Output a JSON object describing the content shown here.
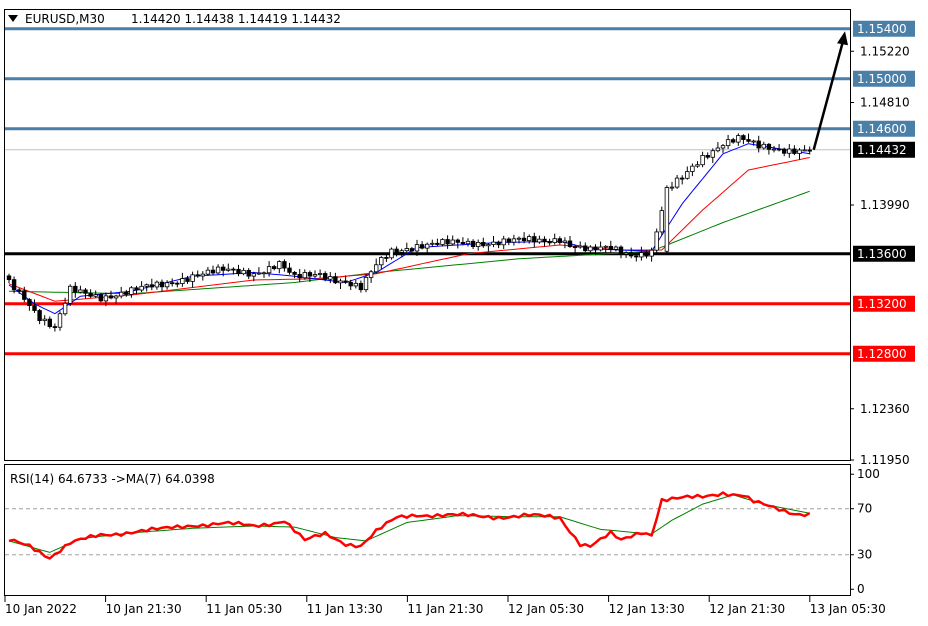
{
  "header": {
    "menu_icon": "triangle-down-icon",
    "symbol": "EURUSD,M30",
    "ohlc": "1.14420 1.14438 1.14419 1.14432"
  },
  "rsi_header": "RSI(14) 64.6733  ->MA(7) 64.0398",
  "colors": {
    "up_candle": "#ffffff",
    "down_candle": "#000000",
    "ma_fast": "#0000ff",
    "ma_mid": "#ff0000",
    "ma_slow": "#008000",
    "resistance_line": "#4a7fa8",
    "support_line": "#ff0000",
    "pivot_line": "#000000",
    "rsi_line": "#ff0000",
    "rsi_ma": "#008000",
    "arrow": "#000000"
  },
  "chart_data": [
    {
      "type": "candlestick",
      "title": "EURUSD,M30",
      "x_ticks": [
        "10 Jan 2022",
        "10 Jan 21:30",
        "11 Jan 05:30",
        "11 Jan 13:30",
        "11 Jan 21:30",
        "12 Jan 05:30",
        "12 Jan 13:30",
        "12 Jan 21:30",
        "13 Jan 05:30"
      ],
      "y_ticks": [
        "1.15220",
        "1.14810",
        "1.13990",
        "1.12360",
        "1.11950"
      ],
      "ylim": [
        1.1195,
        1.1555
      ],
      "current_price": {
        "label": "1.14432",
        "value": 1.14432
      },
      "horizontal_levels": [
        {
          "label": "1.15400",
          "value": 1.154,
          "kind": "resistance"
        },
        {
          "label": "1.15000",
          "value": 1.15,
          "kind": "resistance"
        },
        {
          "label": "1.14600",
          "value": 1.146,
          "kind": "resistance"
        },
        {
          "label": "1.13600",
          "value": 1.136,
          "kind": "pivot"
        },
        {
          "label": "1.13200",
          "value": 1.132,
          "kind": "support"
        },
        {
          "label": "1.12800",
          "value": 1.128,
          "kind": "support"
        }
      ],
      "anchors": [
        [
          0,
          1.1337
        ],
        [
          3,
          1.1326
        ],
        [
          6,
          1.131
        ],
        [
          9,
          1.13
        ],
        [
          12,
          1.133
        ],
        [
          18,
          1.1326
        ],
        [
          24,
          1.133
        ],
        [
          30,
          1.1335
        ],
        [
          36,
          1.1343
        ],
        [
          42,
          1.1346
        ],
        [
          48,
          1.1345
        ],
        [
          53,
          1.1352
        ],
        [
          56,
          1.134
        ],
        [
          61,
          1.1344
        ],
        [
          66,
          1.1338
        ],
        [
          69,
          1.1332
        ],
        [
          72,
          1.135
        ],
        [
          75,
          1.1362
        ],
        [
          80,
          1.1367
        ],
        [
          88,
          1.1368
        ],
        [
          96,
          1.137
        ],
        [
          105,
          1.137
        ],
        [
          108,
          1.1373
        ],
        [
          110,
          1.1368
        ],
        [
          114,
          1.1362
        ],
        [
          118,
          1.1364
        ],
        [
          122,
          1.136
        ],
        [
          126,
          1.1362
        ],
        [
          129,
          1.141
        ],
        [
          132,
          1.142
        ],
        [
          136,
          1.1438
        ],
        [
          140,
          1.1449
        ],
        [
          143,
          1.1452
        ],
        [
          147,
          1.1445
        ],
        [
          152,
          1.1444
        ],
        [
          157,
          1.1443
        ]
      ],
      "ma_fast_anchors": [
        [
          0,
          1.1335
        ],
        [
          5,
          1.132
        ],
        [
          9,
          1.1312
        ],
        [
          14,
          1.1326
        ],
        [
          24,
          1.133
        ],
        [
          36,
          1.1342
        ],
        [
          48,
          1.1345
        ],
        [
          56,
          1.1342
        ],
        [
          66,
          1.1337
        ],
        [
          72,
          1.1345
        ],
        [
          80,
          1.1365
        ],
        [
          96,
          1.1369
        ],
        [
          108,
          1.137
        ],
        [
          114,
          1.1364
        ],
        [
          126,
          1.1362
        ],
        [
          132,
          1.14
        ],
        [
          140,
          1.144
        ],
        [
          145,
          1.1448
        ],
        [
          157,
          1.144
        ]
      ],
      "ma_mid_anchors": [
        [
          0,
          1.1336
        ],
        [
          9,
          1.1322
        ],
        [
          24,
          1.1327
        ],
        [
          48,
          1.1339
        ],
        [
          60,
          1.134
        ],
        [
          72,
          1.1344
        ],
        [
          90,
          1.136
        ],
        [
          108,
          1.1367
        ],
        [
          120,
          1.1363
        ],
        [
          128,
          1.1363
        ],
        [
          136,
          1.1395
        ],
        [
          145,
          1.1427
        ],
        [
          157,
          1.1437
        ]
      ],
      "ma_slow_anchors": [
        [
          0,
          1.133
        ],
        [
          24,
          1.1328
        ],
        [
          56,
          1.1337
        ],
        [
          72,
          1.1345
        ],
        [
          100,
          1.1356
        ],
        [
          126,
          1.1362
        ],
        [
          140,
          1.1385
        ],
        [
          157,
          1.141
        ]
      ]
    },
    {
      "type": "line",
      "title": "RSI(14) 64.6733  ->MA(7) 64.0398",
      "y_ticks": [
        "100",
        "70",
        "30",
        "0"
      ],
      "ylim": [
        -5,
        108
      ],
      "levels": [
        70,
        30
      ],
      "rsi_anchors": [
        [
          0,
          42
        ],
        [
          4,
          38
        ],
        [
          8,
          28
        ],
        [
          12,
          40
        ],
        [
          18,
          47
        ],
        [
          24,
          50
        ],
        [
          30,
          52
        ],
        [
          36,
          56
        ],
        [
          42,
          57
        ],
        [
          48,
          55
        ],
        [
          52,
          58
        ],
        [
          54,
          60
        ],
        [
          58,
          42
        ],
        [
          62,
          48
        ],
        [
          66,
          40
        ],
        [
          69,
          38
        ],
        [
          72,
          50
        ],
        [
          76,
          62
        ],
        [
          80,
          65
        ],
        [
          88,
          64
        ],
        [
          96,
          63
        ],
        [
          102,
          64
        ],
        [
          108,
          62
        ],
        [
          112,
          40
        ],
        [
          114,
          38
        ],
        [
          118,
          48
        ],
        [
          120,
          42
        ],
        [
          124,
          50
        ],
        [
          126,
          48
        ],
        [
          128,
          78
        ],
        [
          132,
          79
        ],
        [
          136,
          80
        ],
        [
          140,
          84
        ],
        [
          144,
          82
        ],
        [
          146,
          76
        ],
        [
          150,
          70
        ],
        [
          154,
          66
        ],
        [
          157,
          66
        ]
      ],
      "ma_anchors": [
        [
          0,
          42
        ],
        [
          8,
          32
        ],
        [
          14,
          44
        ],
        [
          24,
          49
        ],
        [
          36,
          53
        ],
        [
          48,
          55
        ],
        [
          56,
          54
        ],
        [
          64,
          45
        ],
        [
          70,
          42
        ],
        [
          78,
          58
        ],
        [
          88,
          64
        ],
        [
          100,
          63
        ],
        [
          108,
          63
        ],
        [
          116,
          52
        ],
        [
          126,
          48
        ],
        [
          130,
          60
        ],
        [
          136,
          74
        ],
        [
          142,
          82
        ],
        [
          148,
          74
        ],
        [
          157,
          66
        ]
      ]
    }
  ]
}
